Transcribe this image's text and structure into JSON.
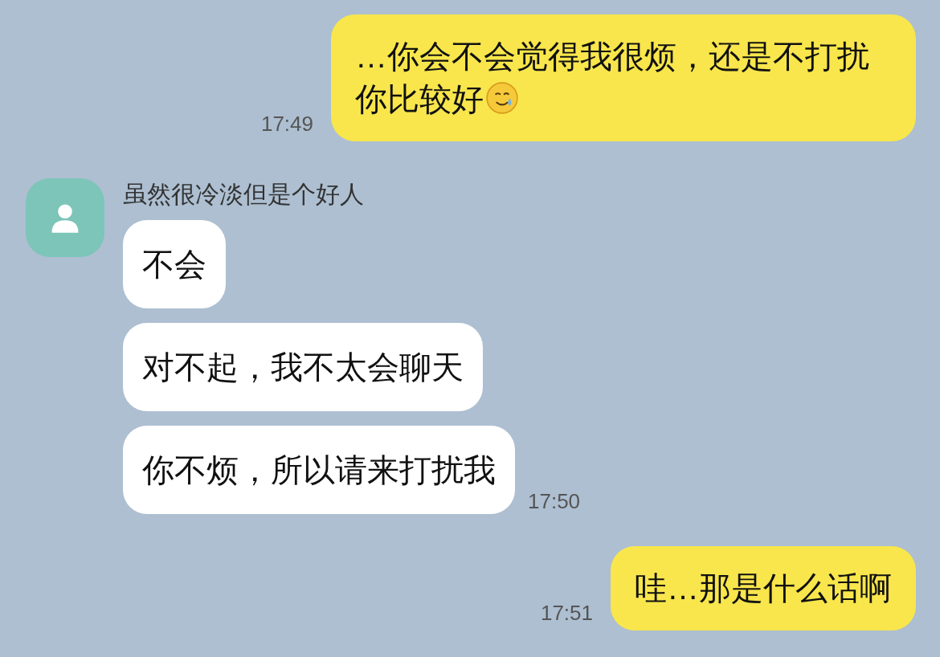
{
  "messages": [
    {
      "kind": "sent",
      "text": "…你会不会觉得我很烦，还是不打扰你比较好",
      "has_emoji": true,
      "time": "17:49"
    },
    {
      "kind": "received",
      "sender": "虽然很冷淡但是个好人",
      "bubbles": [
        "不会",
        "对不起，我不太会聊天",
        "你不烦，所以请来打扰我"
      ],
      "time": "17:50"
    },
    {
      "kind": "sent",
      "text": "哇…那是什么话啊",
      "has_emoji": false,
      "time": "17:51"
    }
  ]
}
